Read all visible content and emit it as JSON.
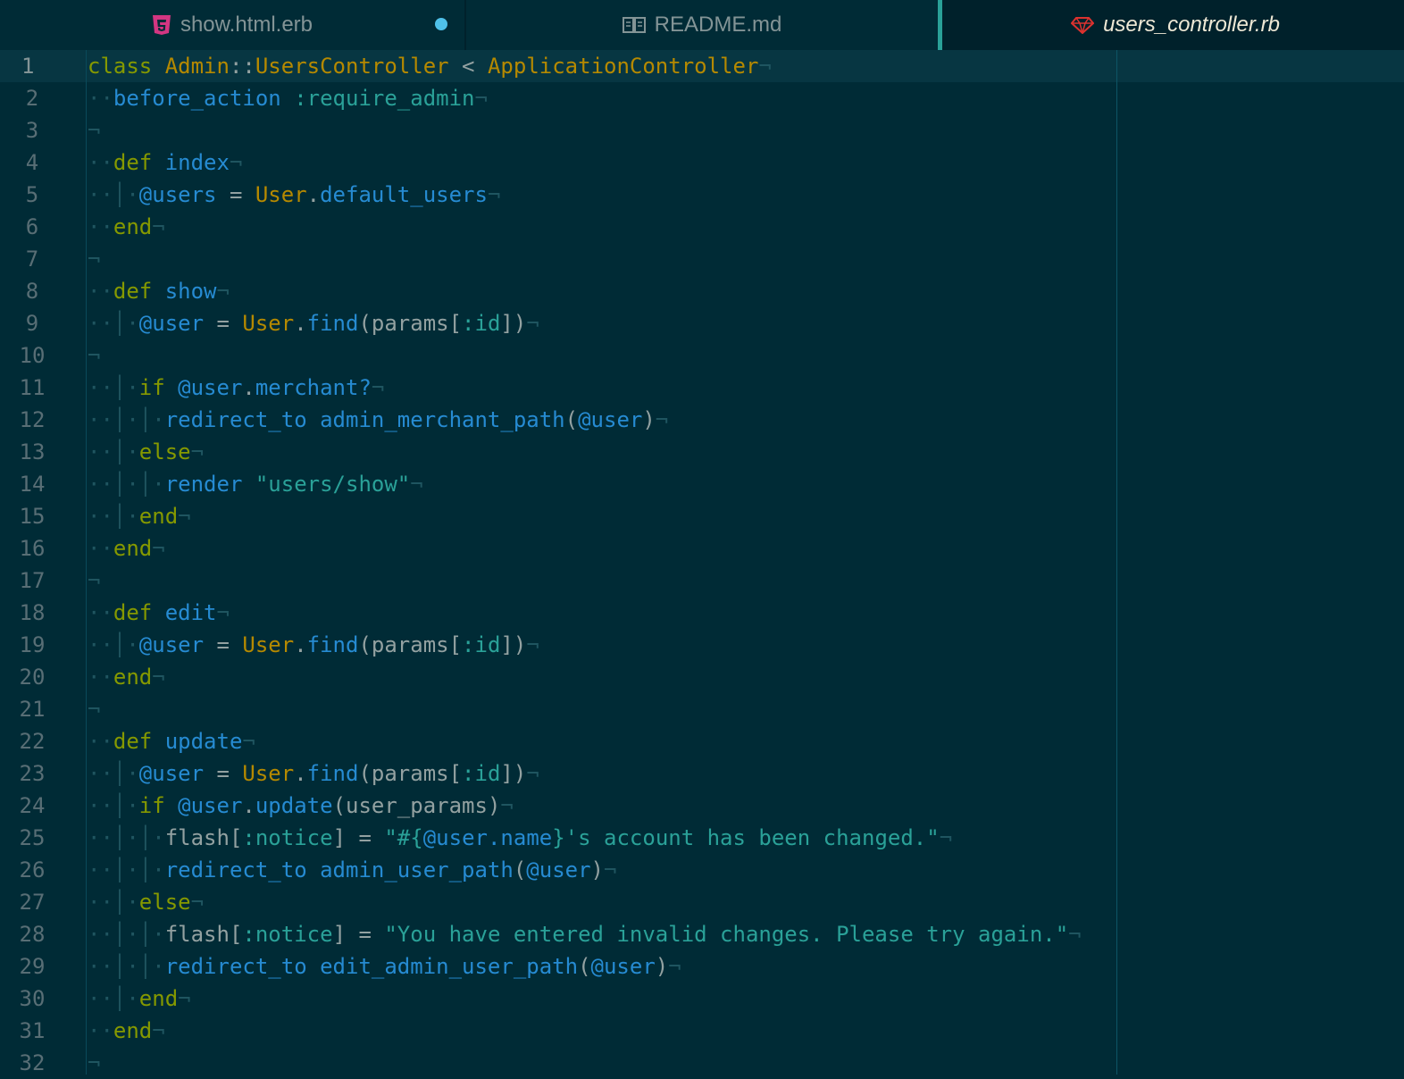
{
  "tabs": [
    {
      "label": "show.html.erb",
      "icon": "html5-icon",
      "modified": true
    },
    {
      "label": "README.md",
      "icon": "book-icon",
      "modified": false
    },
    {
      "label": "users_controller.rb",
      "icon": "ruby-gem-icon",
      "active": true
    }
  ],
  "colors": {
    "background": "#002b36",
    "keyword": "#859900",
    "constant": "#b58900",
    "function": "#268bd2",
    "string": "#2aa198",
    "text": "#93a1a1",
    "line_number": "#586e75",
    "modified_dot": "#4fc1e9"
  },
  "line_numbers": [
    "1",
    "2",
    "3",
    "4",
    "5",
    "6",
    "7",
    "8",
    "9",
    "10",
    "11",
    "12",
    "13",
    "14",
    "15",
    "16",
    "17",
    "18",
    "19",
    "20",
    "21",
    "22",
    "23",
    "24",
    "25",
    "26",
    "27",
    "28",
    "29",
    "30",
    "31",
    "32"
  ],
  "current_line": 1,
  "code": [
    [
      [
        "kw",
        "class "
      ],
      [
        "cls",
        "Admin"
      ],
      [
        "plain",
        "::"
      ],
      [
        "cls",
        "UsersController"
      ],
      [
        "op",
        " < "
      ],
      [
        "cls",
        "ApplicationController"
      ],
      [
        "eol",
        "¬"
      ]
    ],
    [
      [
        "indent",
        "··"
      ],
      [
        "fn",
        "before_action "
      ],
      [
        "sym",
        ":require_admin"
      ],
      [
        "eol",
        "¬"
      ]
    ],
    [
      [
        "eol",
        "¬"
      ]
    ],
    [
      [
        "indent",
        "··"
      ],
      [
        "kw",
        "def "
      ],
      [
        "fn",
        "index"
      ],
      [
        "eol",
        "¬"
      ]
    ],
    [
      [
        "indent",
        "··|·"
      ],
      [
        "ivar",
        "@users"
      ],
      [
        "op",
        " = "
      ],
      [
        "cls",
        "User"
      ],
      [
        "plain",
        "."
      ],
      [
        "fn",
        "default_users"
      ],
      [
        "eol",
        "¬"
      ]
    ],
    [
      [
        "indent",
        "··"
      ],
      [
        "kw",
        "end"
      ],
      [
        "eol",
        "¬"
      ]
    ],
    [
      [
        "eol",
        "¬"
      ]
    ],
    [
      [
        "indent",
        "··"
      ],
      [
        "kw",
        "def "
      ],
      [
        "fn",
        "show"
      ],
      [
        "eol",
        "¬"
      ]
    ],
    [
      [
        "indent",
        "··|·"
      ],
      [
        "ivar",
        "@user"
      ],
      [
        "op",
        " = "
      ],
      [
        "cls",
        "User"
      ],
      [
        "plain",
        "."
      ],
      [
        "fn",
        "find"
      ],
      [
        "plain",
        "(params["
      ],
      [
        "sym",
        ":id"
      ],
      [
        "plain",
        "])"
      ],
      [
        "eol",
        "¬"
      ]
    ],
    [
      [
        "eol",
        "¬"
      ]
    ],
    [
      [
        "indent",
        "··|·"
      ],
      [
        "kw",
        "if "
      ],
      [
        "ivar",
        "@user"
      ],
      [
        "plain",
        "."
      ],
      [
        "fn",
        "merchant?"
      ],
      [
        "eol",
        "¬"
      ]
    ],
    [
      [
        "indent",
        "··|·|·"
      ],
      [
        "fn",
        "redirect_to admin_merchant_path"
      ],
      [
        "plain",
        "("
      ],
      [
        "ivar",
        "@user"
      ],
      [
        "plain",
        ")"
      ],
      [
        "eol",
        "¬"
      ]
    ],
    [
      [
        "indent",
        "··|·"
      ],
      [
        "kw",
        "else"
      ],
      [
        "eol",
        "¬"
      ]
    ],
    [
      [
        "indent",
        "··|·|·"
      ],
      [
        "fn",
        "render "
      ],
      [
        "str",
        "\"users/show\""
      ],
      [
        "eol",
        "¬"
      ]
    ],
    [
      [
        "indent",
        "··|·"
      ],
      [
        "kw",
        "end"
      ],
      [
        "eol",
        "¬"
      ]
    ],
    [
      [
        "indent",
        "··"
      ],
      [
        "kw",
        "end"
      ],
      [
        "eol",
        "¬"
      ]
    ],
    [
      [
        "eol",
        "¬"
      ]
    ],
    [
      [
        "indent",
        "··"
      ],
      [
        "kw",
        "def "
      ],
      [
        "fn",
        "edit"
      ],
      [
        "eol",
        "¬"
      ]
    ],
    [
      [
        "indent",
        "··|·"
      ],
      [
        "ivar",
        "@user"
      ],
      [
        "op",
        " = "
      ],
      [
        "cls",
        "User"
      ],
      [
        "plain",
        "."
      ],
      [
        "fn",
        "find"
      ],
      [
        "plain",
        "(params["
      ],
      [
        "sym",
        ":id"
      ],
      [
        "plain",
        "])"
      ],
      [
        "eol",
        "¬"
      ]
    ],
    [
      [
        "indent",
        "··"
      ],
      [
        "kw",
        "end"
      ],
      [
        "eol",
        "¬"
      ]
    ],
    [
      [
        "eol",
        "¬"
      ]
    ],
    [
      [
        "indent",
        "··"
      ],
      [
        "kw",
        "def "
      ],
      [
        "fn",
        "update"
      ],
      [
        "eol",
        "¬"
      ]
    ],
    [
      [
        "indent",
        "··|·"
      ],
      [
        "ivar",
        "@user"
      ],
      [
        "op",
        " = "
      ],
      [
        "cls",
        "User"
      ],
      [
        "plain",
        "."
      ],
      [
        "fn",
        "find"
      ],
      [
        "plain",
        "(params["
      ],
      [
        "sym",
        ":id"
      ],
      [
        "plain",
        "])"
      ],
      [
        "eol",
        "¬"
      ]
    ],
    [
      [
        "indent",
        "··|·"
      ],
      [
        "kw",
        "if "
      ],
      [
        "ivar",
        "@user"
      ],
      [
        "plain",
        "."
      ],
      [
        "fn",
        "update"
      ],
      [
        "plain",
        "(user_params)"
      ],
      [
        "eol",
        "¬"
      ]
    ],
    [
      [
        "indent",
        "··|·|·"
      ],
      [
        "plain",
        "flash["
      ],
      [
        "sym",
        ":notice"
      ],
      [
        "plain",
        "] = "
      ],
      [
        "str",
        "\"#{"
      ],
      [
        "ivar",
        "@user.name"
      ],
      [
        "str",
        "}'s account has been changed.\""
      ],
      [
        "eol",
        "¬"
      ]
    ],
    [
      [
        "indent",
        "··|·|·"
      ],
      [
        "fn",
        "redirect_to admin_user_path"
      ],
      [
        "plain",
        "("
      ],
      [
        "ivar",
        "@user"
      ],
      [
        "plain",
        ")"
      ],
      [
        "eol",
        "¬"
      ]
    ],
    [
      [
        "indent",
        "··|·"
      ],
      [
        "kw",
        "else"
      ],
      [
        "eol",
        "¬"
      ]
    ],
    [
      [
        "indent",
        "··|·|·"
      ],
      [
        "plain",
        "flash["
      ],
      [
        "sym",
        ":notice"
      ],
      [
        "plain",
        "] = "
      ],
      [
        "str",
        "\"You have entered invalid changes. Please try again.\""
      ],
      [
        "eol",
        "¬"
      ]
    ],
    [
      [
        "indent",
        "··|·|·"
      ],
      [
        "fn",
        "redirect_to edit_admin_user_path"
      ],
      [
        "plain",
        "("
      ],
      [
        "ivar",
        "@user"
      ],
      [
        "plain",
        ")"
      ],
      [
        "eol",
        "¬"
      ]
    ],
    [
      [
        "indent",
        "··|·"
      ],
      [
        "kw",
        "end"
      ],
      [
        "eol",
        "¬"
      ]
    ],
    [
      [
        "indent",
        "··"
      ],
      [
        "kw",
        "end"
      ],
      [
        "eol",
        "¬"
      ]
    ],
    [
      [
        "eol",
        "¬"
      ]
    ]
  ]
}
